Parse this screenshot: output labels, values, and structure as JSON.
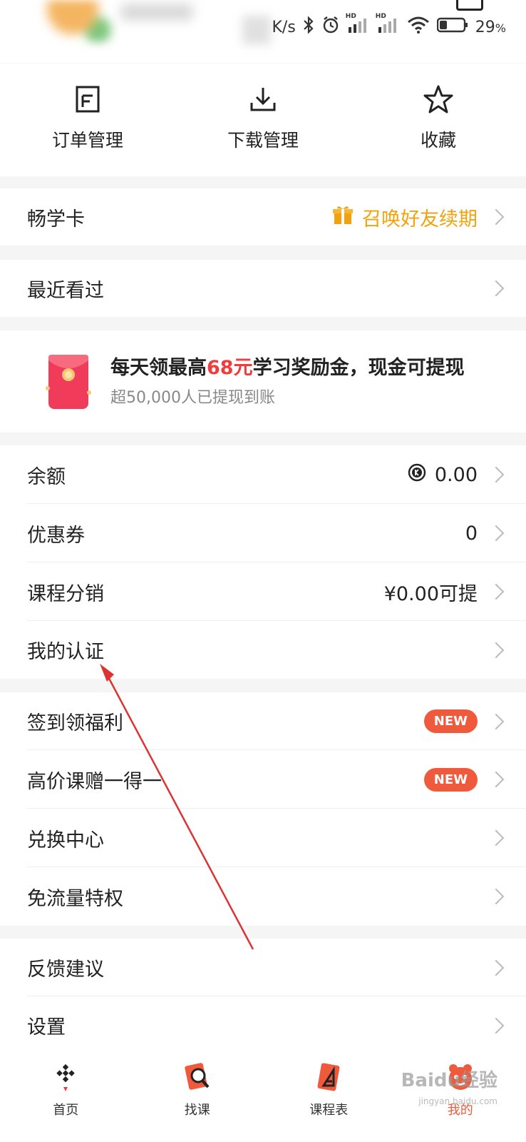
{
  "status_bar": {
    "speed": "K/s",
    "battery_percent": "29",
    "battery_suffix": "%",
    "hd1": "HD",
    "hd2": "HD"
  },
  "quick_actions": [
    {
      "label": "订单管理",
      "icon": "document-icon"
    },
    {
      "label": "下载管理",
      "icon": "download-icon"
    },
    {
      "label": "收藏",
      "icon": "star-icon"
    }
  ],
  "changxue": {
    "title": "畅学卡",
    "right_text": "召唤好友续期",
    "icon": "gift-icon"
  },
  "recent": {
    "title": "最近看过"
  },
  "promo": {
    "headline_pre": "每天领最高",
    "headline_highlight": "68元",
    "headline_post": "学习奖励金，现金可提现",
    "sub": "超50,000人已提现到账"
  },
  "wallet": [
    {
      "title": "余额",
      "value": "0.00",
      "icon": "coin-icon"
    },
    {
      "title": "优惠券",
      "value": "0"
    },
    {
      "title": "课程分销",
      "value": "¥0.00可提"
    },
    {
      "title": "我的认证",
      "value": ""
    }
  ],
  "benefits": [
    {
      "title": "签到领福利",
      "badge": "NEW"
    },
    {
      "title": "高价课赠一得一",
      "badge": "NEW"
    },
    {
      "title": "兑换中心",
      "badge": ""
    },
    {
      "title": "免流量特权",
      "badge": ""
    }
  ],
  "settings": [
    {
      "title": "反馈建议"
    },
    {
      "title": "设置"
    }
  ],
  "tabs": [
    {
      "label": "首页",
      "icon": "home-icon"
    },
    {
      "label": "找课",
      "icon": "search-course-icon"
    },
    {
      "label": "课程表",
      "icon": "schedule-icon"
    },
    {
      "label": "我的",
      "icon": "profile-icon",
      "active": true
    }
  ],
  "watermark": {
    "text": "Baidu经验",
    "url": "jingyan.baidu.com"
  },
  "colors": {
    "accent": "#f05a3c",
    "orange": "#f2a20c",
    "highlight_red": "#f03c3c"
  }
}
